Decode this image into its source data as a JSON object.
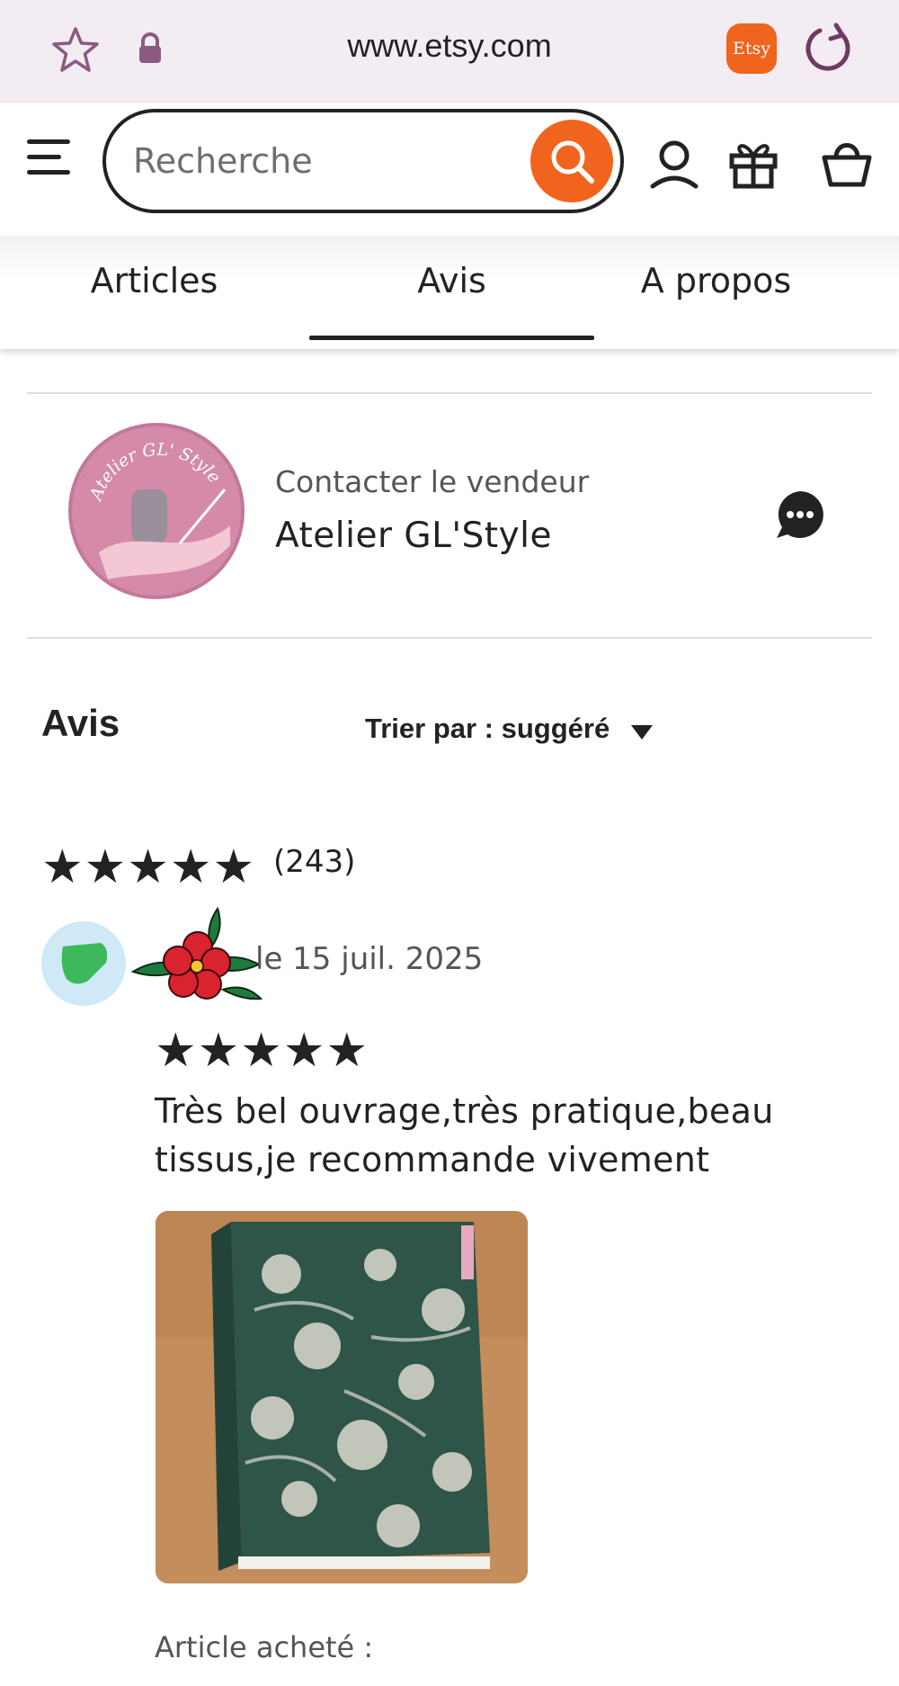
{
  "browser": {
    "url": "www.etsy.com",
    "etsy_badge": "Etsy",
    "icons": [
      "star-icon",
      "lock-icon",
      "reload-icon"
    ]
  },
  "header": {
    "search_placeholder": "Recherche",
    "icons": [
      "menu-icon",
      "search-icon",
      "account-icon",
      "gift-icon",
      "cart-icon"
    ],
    "accent_color": "#f1641e"
  },
  "tabs": [
    {
      "label": "Articles",
      "active": false
    },
    {
      "label": "Avis",
      "active": true
    },
    {
      "label": "A propos",
      "active": false
    }
  ],
  "seller": {
    "logo_text": "Atelier GL' Style",
    "contact_label": "Contacter le vendeur",
    "name": "Atelier GL'Style"
  },
  "reviews": {
    "title": "Avis",
    "sort_label": "Trier par : suggéré",
    "overall_rating": 5,
    "count": "(243)",
    "items": [
      {
        "date": "le 15 juil. 2025",
        "rating": 5,
        "text": "Très bel ouvrage,très pratique,beau tissus,je recommande vivement",
        "purchased_label": "Article acheté :"
      }
    ]
  }
}
